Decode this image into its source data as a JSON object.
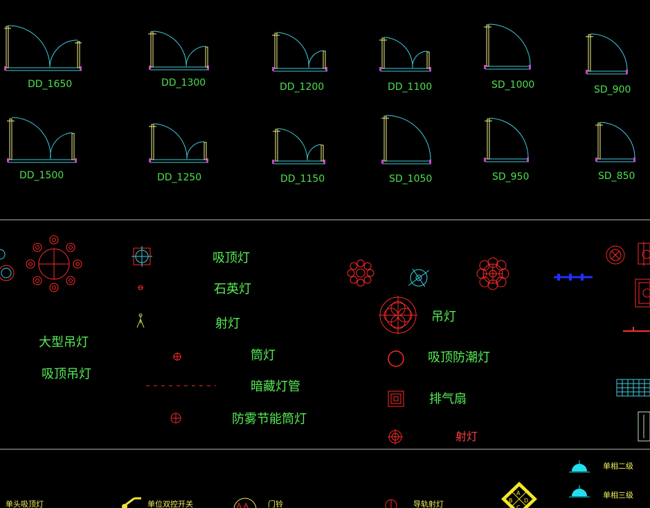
{
  "doors_row1": [
    "DD_1650",
    "DD_1300",
    "DD_1200",
    "DD_1100",
    "SD_1000",
    "SD_900"
  ],
  "doors_row2": [
    "DD_1500",
    "DD_1250",
    "DD_1150",
    "SD_1050",
    "SD_950",
    "SD_850"
  ],
  "lights_left": {
    "large_chandelier": "大型吊灯",
    "ceiling_chandelier": "吸顶吊灯"
  },
  "lights_mid": [
    "吸顶灯",
    "石英灯",
    "射灯",
    "筒灯",
    "暗藏灯管",
    "防雾节能筒灯"
  ],
  "lights_right": [
    "吊灯",
    "吸顶防潮灯",
    "排气扇",
    "射灯"
  ],
  "bottom": {
    "single_ceiling": "单头吸顶灯",
    "single_double_switch": "单位双控开关",
    "door_bell": "门铃",
    "guide_spotlight": "导轨射灯",
    "junction_labels": [
      "A",
      "B",
      "C",
      "D"
    ],
    "phase2": "单相二级",
    "phase3": "单相三级"
  },
  "colors": {
    "background": "#000000",
    "door_arc": "#3fd0e0",
    "door_frame": "#f4f48c",
    "door_sill": "#d040d0",
    "label_green": "#4ee04e",
    "symbol_red": "#ff2020",
    "accent_blue": "#2030ff",
    "accent_yellow": "#f2e62a"
  }
}
